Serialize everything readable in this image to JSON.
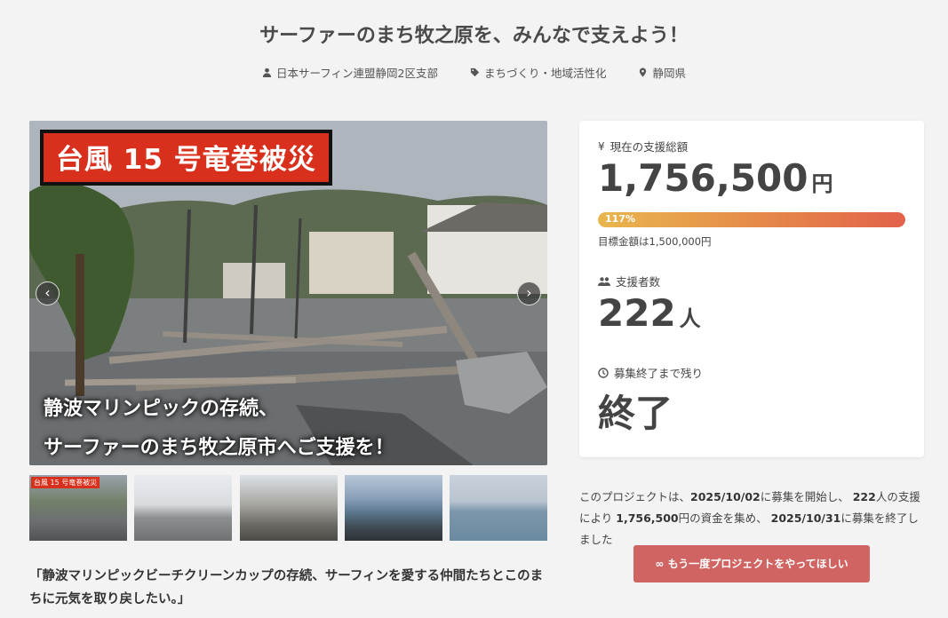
{
  "header": {
    "title": "サーファーのまち牧之原を、みんなで支えよう！",
    "organizer": "日本サーフィン連盟静岡2区支部",
    "category": "まちづくり・地域活性化",
    "location": "静岡県"
  },
  "hero": {
    "banner": "台風 15 号竜巻被災",
    "caption_line1": "静波マリンピックの存続、",
    "caption_line2": "サーファーのまち牧之原市へご支援を！",
    "prev_label": "‹",
    "next_label": "›"
  },
  "thumbnails": [
    {
      "label": "台風 15 号竜巻被災"
    },
    {
      "label": ""
    },
    {
      "label": ""
    },
    {
      "label": ""
    },
    {
      "label": ""
    }
  ],
  "quote": "「静波マリンピックビーチクリーンカップの存続、サーフィンを愛する仲間たちとこのまちに元気を取り戻したい。」",
  "stats": {
    "total_label": "現在の支援総額",
    "total_amount": "1,756,500",
    "total_unit": "円",
    "progress_percent": 117,
    "progress_text": "117%",
    "goal_text": "目標金額は1,500,000円",
    "supporters_label": "支援者数",
    "supporters_count": "222",
    "supporters_unit": "人",
    "remaining_label": "募集終了まで残り",
    "remaining_value": "終了"
  },
  "summary": {
    "prefix": "このプロジェクトは、",
    "start_date": "2025/10/02",
    "part2": "に募集を開始し、",
    "supporters": "222",
    "part3": "人の支援により",
    "amount": "1,756,500",
    "part4": "円の資金を集め、",
    "end_date": "2025/10/31",
    "part5": "に募集を終了しました"
  },
  "cta": {
    "label": "∞  もう一度プロジェクトをやってほしい"
  },
  "colors": {
    "accent": "#cf6462",
    "banner": "#d8301c",
    "progress_start": "#e8b64d",
    "progress_end": "#e2624a"
  }
}
